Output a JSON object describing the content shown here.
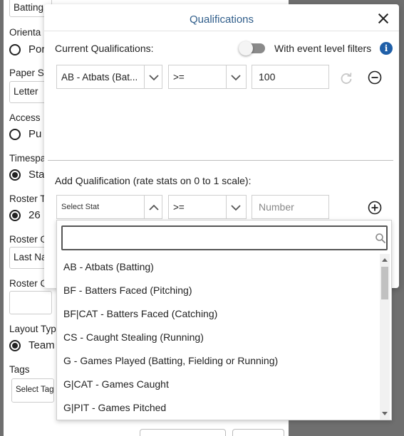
{
  "background_form": {
    "top_field_value": "Batting",
    "orientation_label": "Orienta",
    "orientation_option": "Por",
    "paper_size_label": "Paper S",
    "paper_size_value": "Letter",
    "access_label": "Access",
    "access_option": "Pu",
    "timespan_label": "Timespa",
    "timespan_option": "Sta",
    "roster_t_label": "Roster T",
    "roster_t_option": "26",
    "roster_o_label": "Roster O",
    "roster_o_value": "Last Na",
    "roster_c_label": "Roster C",
    "layout_label": "Layout Typ",
    "layout_option": "Team",
    "tags_label": "Tags",
    "tags_placeholder": "Select Tag"
  },
  "modal": {
    "title": "Qualifications",
    "current_label": "Current Qualifications:",
    "event_filter_label": "With event level filters",
    "event_filter_on": false,
    "current_row": {
      "stat": "AB - Atbats (Bat...",
      "operator": ">=",
      "value": "100"
    },
    "add_label": "Add Qualification (rate stats on 0 to 1 scale):",
    "add_row": {
      "stat_placeholder": "Select Stat",
      "operator": ">=",
      "value_placeholder": "Number"
    }
  },
  "dropdown": {
    "search_value": "",
    "options": [
      "AB - Atbats (Batting)",
      "BF - Batters Faced (Pitching)",
      "BF|CAT - Batters Faced (Catching)",
      "CS - Caught Stealing (Running)",
      "G - Games Played (Batting, Fielding or Running)",
      "G|CAT - Games Caught",
      "G|PIT - Games Pitched"
    ]
  },
  "colors": {
    "title": "#2f5d8a",
    "info_icon": "#1f5fa8",
    "overlay": "#6f6f6f"
  }
}
